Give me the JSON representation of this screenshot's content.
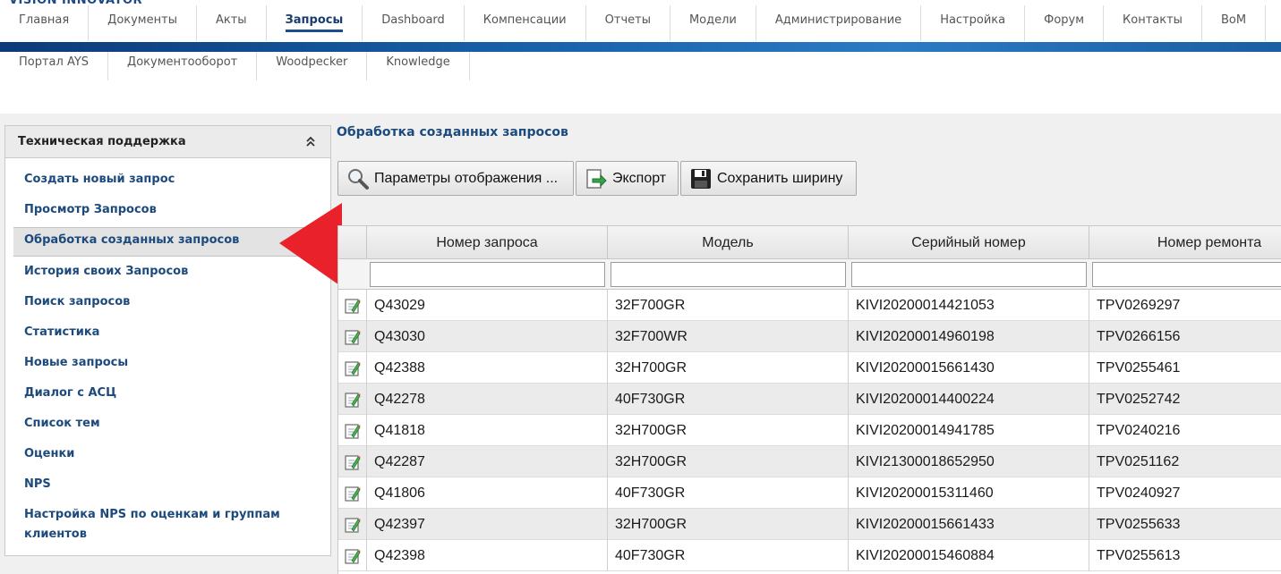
{
  "brand": {
    "logo_text": "VISION INNOVATOR"
  },
  "topnav": {
    "items": [
      {
        "label": "Главная"
      },
      {
        "label": "Документы"
      },
      {
        "label": "Акты"
      },
      {
        "label": "Запросы",
        "active": true
      },
      {
        "label": "Dashboard"
      },
      {
        "label": "Компенсации"
      },
      {
        "label": "Отчеты"
      },
      {
        "label": "Модели"
      },
      {
        "label": "Администрирование"
      },
      {
        "label": "Настройка"
      },
      {
        "label": "Форум"
      },
      {
        "label": "Контакты"
      },
      {
        "label": "BoM"
      }
    ]
  },
  "subnav": {
    "items": [
      {
        "label": "Портал AYS"
      },
      {
        "label": "Документооборот"
      },
      {
        "label": "Woodpecker"
      },
      {
        "label": "Knowledge"
      }
    ]
  },
  "sidebar": {
    "title": "Техническая поддержка",
    "items": [
      {
        "label": "Создать новый запрос"
      },
      {
        "label": "Просмотр Запросов"
      },
      {
        "label": "Обработка созданных запросов",
        "selected": true
      },
      {
        "label": "История своих Запросов"
      },
      {
        "label": "Поиск запросов"
      },
      {
        "label": "Статистика"
      },
      {
        "label": "Новые запросы"
      },
      {
        "label": "Диалог с АСЦ"
      },
      {
        "label": "Список тем"
      },
      {
        "label": "Оценки"
      },
      {
        "label": "NPS"
      },
      {
        "label": "Настройка NPS по оценкам и группам клиентов"
      }
    ]
  },
  "page": {
    "title": "Обработка созданных запросов"
  },
  "toolbar": {
    "display_params": "Параметры отображения ...",
    "export": "Экспорт",
    "save_width": "Сохранить ширину"
  },
  "grid": {
    "columns": [
      "",
      "Номер запроса",
      "Модель",
      "Серийный номер",
      "Номер ремонта"
    ],
    "rows": [
      [
        "Q43029",
        "32F700GR",
        "KIVI20200014421053",
        "TPV0269297"
      ],
      [
        "Q43030",
        "32F700WR",
        "KIVI20200014960198",
        "TPV0266156"
      ],
      [
        "Q42388",
        "32H700GR",
        "KIVI20200015661430",
        "TPV0255461"
      ],
      [
        "Q42278",
        "40F730GR",
        "KIVI20200014400224",
        "TPV0252742"
      ],
      [
        "Q41818",
        "32H700GR",
        "KIVI20200014941785",
        "TPV0240216"
      ],
      [
        "Q42287",
        "32H700GR",
        "KIVI21300018652950",
        "TPV0251162"
      ],
      [
        "Q41806",
        "40F730GR",
        "KIVI20200015311460",
        "TPV0240927"
      ],
      [
        "Q42397",
        "32H700GR",
        "KIVI20200015661433",
        "TPV0255633"
      ],
      [
        "Q42398",
        "40F730GR",
        "KIVI20200015460884",
        "TPV0255613"
      ]
    ]
  },
  "colors": {
    "accent_blue": "#1660a8",
    "link_blue": "#1d4a7c",
    "arrow_red": "#e8212b"
  }
}
